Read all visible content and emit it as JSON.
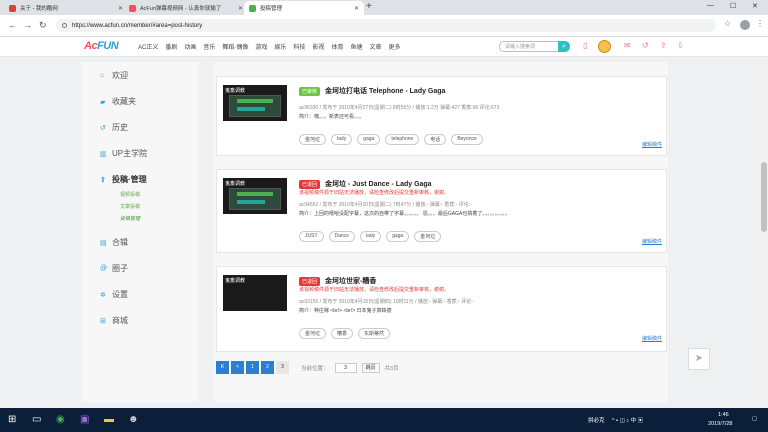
{
  "browser": {
    "tabs": [
      {
        "label": "关于 - 我的酷网",
        "active": false
      },
      {
        "label": "AcFun弹幕视频网 - 认真你就输了",
        "active": false
      },
      {
        "label": "投稿管理",
        "active": true
      }
    ],
    "url": "https://www.acfun.cn/member/#area=post-history"
  },
  "site": {
    "logo_a": "Ac",
    "logo_b": "FUN",
    "menu": [
      "AC正义",
      "番剧",
      "动画",
      "音乐",
      "舞蹈·偶像",
      "游戏",
      "娱乐",
      "科技",
      "影视",
      "体育",
      "鱼塘",
      "文章",
      "更多"
    ],
    "search_placeholder": "请输入搜索词"
  },
  "sidebar": {
    "items": [
      {
        "label": "欢迎",
        "icon": "home-icon"
      },
      {
        "label": "收藏夹",
        "icon": "folder-icon"
      },
      {
        "label": "历史",
        "icon": "history-icon"
      },
      {
        "label": "UP主学院",
        "icon": "bank-icon"
      },
      {
        "label": "投稿·管理",
        "icon": "upload-icon"
      },
      {
        "label": "合辑",
        "icon": "book-icon"
      },
      {
        "label": "圈子",
        "icon": "at-icon"
      },
      {
        "label": "设置",
        "icon": "gear-icon"
      },
      {
        "label": "商城",
        "icon": "gift-icon"
      }
    ],
    "subitems": [
      "视频投稿",
      "文章投稿",
      "投稿管理"
    ]
  },
  "posts": [
    {
      "status": "已审核",
      "title": "金坷垃打电话 Telephone - Lady Gaga",
      "warning": "",
      "meta": "ac96330 / 发布于 2010年4月27日(星期二) 8时55分 / 播放:1.2万 弹幕:427 香蕉:96 评论:673",
      "intro": "简介：噢。。。新表还可看。。。",
      "tags": [
        "金坷垃",
        "lady",
        "gaga",
        "telephone",
        "电话",
        "Beyonce"
      ],
      "edit": "编辑稿件",
      "thumb_label": "鬼畜调教"
    },
    {
      "status": "已退回",
      "title": "金坷垃 - Just Dance - Lady Gaga",
      "warning": "该视频稿件源于旧站无法播放，请检查修改后提交重新审核，谢谢。",
      "meta": "ac94552 / 发布于 2010年4月20日(星期二) 7时47分 / 播放:- 弹幕:- 香蕉:- 评论:-",
      "intro": "简介：上回的嘻哈没配字幕，这次的自带了字幕。。。。。。 恩。。。最后GAGA也搞着了。。。。。。。。。。",
      "tags": [
        "JUST",
        "Dance",
        "lady",
        "gaga",
        "金坷垃"
      ],
      "edit": "编辑稿件",
      "thumb_label": "鬼畜调教"
    },
    {
      "status": "已退回",
      "title": "金坷垃世家-糟香",
      "warning": "该视频稿件源于旧站无法播放，请检查修改后提交重新审核，谢谢。",
      "meta": "ac93156 / 发布于 2010年4月15日(星期四) 10时11分 / 播放:- 弹幕:- 香蕉:- 评论:-",
      "intro": "简介：种庄稼 <br/> <br/> 日本鬼子真缺德",
      "tags": [
        "金坷垃",
        "糟香",
        "东斯蒂然"
      ],
      "edit": "编辑稿件",
      "thumb_label": "鬼畜调教"
    }
  ],
  "pagination": {
    "first": "K",
    "prev": "<",
    "pages": [
      "1",
      "2",
      "3"
    ],
    "current_label": "当前位置：",
    "current_value": "3",
    "go": "跳页",
    "total": "共3页"
  },
  "taskbar": {
    "ime": "拼必克",
    "time": "1:46",
    "date": "2019/7/28"
  },
  "colors": {
    "brand_red": "#fd4c5d",
    "brand_blue": "#2aa1d8",
    "pager_blue": "#2a7fd0",
    "approved_green": "#6cc644",
    "rejected_red": "#e53935"
  }
}
